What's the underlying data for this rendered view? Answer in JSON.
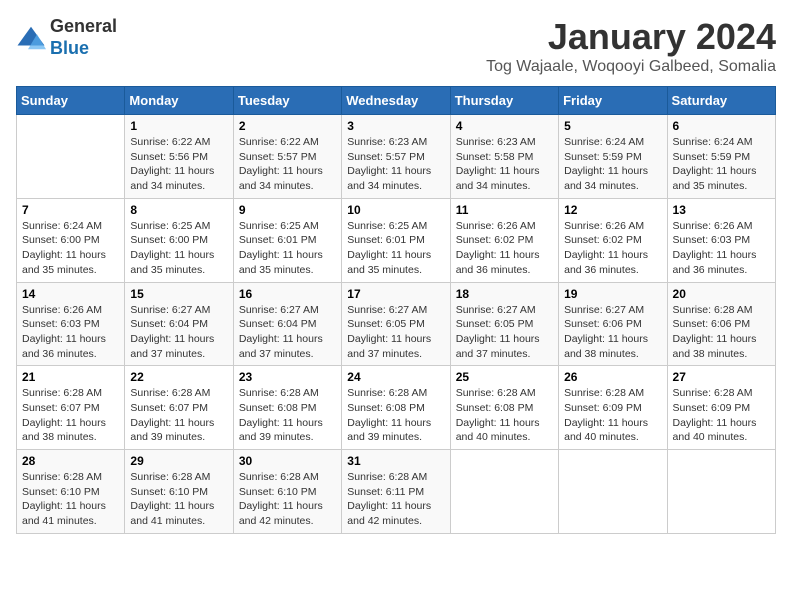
{
  "header": {
    "logo_line1": "General",
    "logo_line2": "Blue",
    "title": "January 2024",
    "subtitle": "Tog Wajaale, Woqooyi Galbeed, Somalia"
  },
  "calendar": {
    "weekdays": [
      "Sunday",
      "Monday",
      "Tuesday",
      "Wednesday",
      "Thursday",
      "Friday",
      "Saturday"
    ],
    "weeks": [
      [
        {
          "day": "",
          "info": ""
        },
        {
          "day": "1",
          "info": "Sunrise: 6:22 AM\nSunset: 5:56 PM\nDaylight: 11 hours\nand 34 minutes."
        },
        {
          "day": "2",
          "info": "Sunrise: 6:22 AM\nSunset: 5:57 PM\nDaylight: 11 hours\nand 34 minutes."
        },
        {
          "day": "3",
          "info": "Sunrise: 6:23 AM\nSunset: 5:57 PM\nDaylight: 11 hours\nand 34 minutes."
        },
        {
          "day": "4",
          "info": "Sunrise: 6:23 AM\nSunset: 5:58 PM\nDaylight: 11 hours\nand 34 minutes."
        },
        {
          "day": "5",
          "info": "Sunrise: 6:24 AM\nSunset: 5:59 PM\nDaylight: 11 hours\nand 34 minutes."
        },
        {
          "day": "6",
          "info": "Sunrise: 6:24 AM\nSunset: 5:59 PM\nDaylight: 11 hours\nand 35 minutes."
        }
      ],
      [
        {
          "day": "7",
          "info": "Sunrise: 6:24 AM\nSunset: 6:00 PM\nDaylight: 11 hours\nand 35 minutes."
        },
        {
          "day": "8",
          "info": "Sunrise: 6:25 AM\nSunset: 6:00 PM\nDaylight: 11 hours\nand 35 minutes."
        },
        {
          "day": "9",
          "info": "Sunrise: 6:25 AM\nSunset: 6:01 PM\nDaylight: 11 hours\nand 35 minutes."
        },
        {
          "day": "10",
          "info": "Sunrise: 6:25 AM\nSunset: 6:01 PM\nDaylight: 11 hours\nand 35 minutes."
        },
        {
          "day": "11",
          "info": "Sunrise: 6:26 AM\nSunset: 6:02 PM\nDaylight: 11 hours\nand 36 minutes."
        },
        {
          "day": "12",
          "info": "Sunrise: 6:26 AM\nSunset: 6:02 PM\nDaylight: 11 hours\nand 36 minutes."
        },
        {
          "day": "13",
          "info": "Sunrise: 6:26 AM\nSunset: 6:03 PM\nDaylight: 11 hours\nand 36 minutes."
        }
      ],
      [
        {
          "day": "14",
          "info": "Sunrise: 6:26 AM\nSunset: 6:03 PM\nDaylight: 11 hours\nand 36 minutes."
        },
        {
          "day": "15",
          "info": "Sunrise: 6:27 AM\nSunset: 6:04 PM\nDaylight: 11 hours\nand 37 minutes."
        },
        {
          "day": "16",
          "info": "Sunrise: 6:27 AM\nSunset: 6:04 PM\nDaylight: 11 hours\nand 37 minutes."
        },
        {
          "day": "17",
          "info": "Sunrise: 6:27 AM\nSunset: 6:05 PM\nDaylight: 11 hours\nand 37 minutes."
        },
        {
          "day": "18",
          "info": "Sunrise: 6:27 AM\nSunset: 6:05 PM\nDaylight: 11 hours\nand 37 minutes."
        },
        {
          "day": "19",
          "info": "Sunrise: 6:27 AM\nSunset: 6:06 PM\nDaylight: 11 hours\nand 38 minutes."
        },
        {
          "day": "20",
          "info": "Sunrise: 6:28 AM\nSunset: 6:06 PM\nDaylight: 11 hours\nand 38 minutes."
        }
      ],
      [
        {
          "day": "21",
          "info": "Sunrise: 6:28 AM\nSunset: 6:07 PM\nDaylight: 11 hours\nand 38 minutes."
        },
        {
          "day": "22",
          "info": "Sunrise: 6:28 AM\nSunset: 6:07 PM\nDaylight: 11 hours\nand 39 minutes."
        },
        {
          "day": "23",
          "info": "Sunrise: 6:28 AM\nSunset: 6:08 PM\nDaylight: 11 hours\nand 39 minutes."
        },
        {
          "day": "24",
          "info": "Sunrise: 6:28 AM\nSunset: 6:08 PM\nDaylight: 11 hours\nand 39 minutes."
        },
        {
          "day": "25",
          "info": "Sunrise: 6:28 AM\nSunset: 6:08 PM\nDaylight: 11 hours\nand 40 minutes."
        },
        {
          "day": "26",
          "info": "Sunrise: 6:28 AM\nSunset: 6:09 PM\nDaylight: 11 hours\nand 40 minutes."
        },
        {
          "day": "27",
          "info": "Sunrise: 6:28 AM\nSunset: 6:09 PM\nDaylight: 11 hours\nand 40 minutes."
        }
      ],
      [
        {
          "day": "28",
          "info": "Sunrise: 6:28 AM\nSunset: 6:10 PM\nDaylight: 11 hours\nand 41 minutes."
        },
        {
          "day": "29",
          "info": "Sunrise: 6:28 AM\nSunset: 6:10 PM\nDaylight: 11 hours\nand 41 minutes."
        },
        {
          "day": "30",
          "info": "Sunrise: 6:28 AM\nSunset: 6:10 PM\nDaylight: 11 hours\nand 42 minutes."
        },
        {
          "day": "31",
          "info": "Sunrise: 6:28 AM\nSunset: 6:11 PM\nDaylight: 11 hours\nand 42 minutes."
        },
        {
          "day": "",
          "info": ""
        },
        {
          "day": "",
          "info": ""
        },
        {
          "day": "",
          "info": ""
        }
      ]
    ]
  }
}
